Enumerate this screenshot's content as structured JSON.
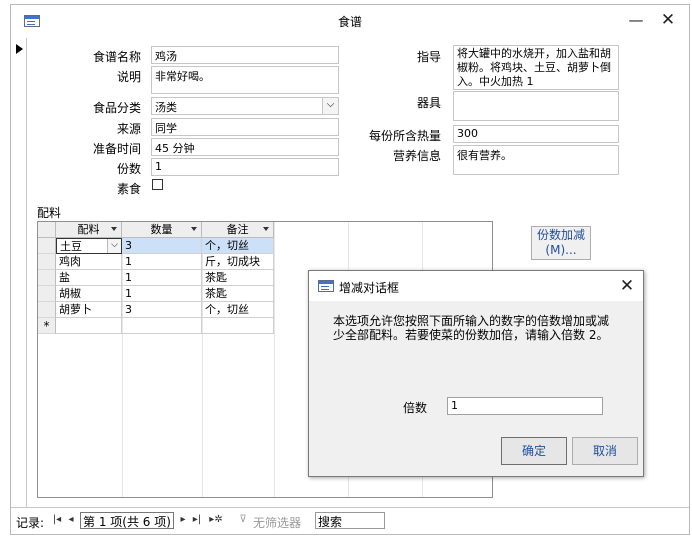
{
  "window": {
    "title": "食谱",
    "minimize_glyph": "—",
    "close_glyph": "✕"
  },
  "form": {
    "name_label": "食谱名称",
    "name_value": "鸡汤",
    "desc_label": "说明",
    "desc_value": "非常好喝。",
    "category_label": "食品分类",
    "category_value": "汤类",
    "source_label": "来源",
    "source_value": "同学",
    "prep_label": "准备时间",
    "prep_value": "45 分钟",
    "servings_label": "份数",
    "servings_value": "1",
    "veg_label": "素食",
    "veg_checked": false,
    "guide_label": "指导",
    "guide_value": "将大罐中的水烧开，加入盐和胡椒粉。将鸡块、土豆、胡萝卜倒入。中火加热 1",
    "tools_label": "器具",
    "tools_value": "",
    "calories_label": "每份所含热量",
    "calories_value": "300",
    "nutrition_label": "营养信息",
    "nutrition_value": "很有营养。"
  },
  "subform": {
    "label": "配料",
    "columns": [
      "配料",
      "数量",
      "备注"
    ],
    "rows": [
      [
        "土豆",
        "3",
        "个，切丝"
      ],
      [
        "鸡肉",
        "1",
        "斤，切成块"
      ],
      [
        "盐",
        "1",
        "茶匙"
      ],
      [
        "胡椒",
        "1",
        "茶匙"
      ],
      [
        "胡萝卜",
        "3",
        "个，切丝"
      ]
    ],
    "new_row_marker": "*"
  },
  "scale_button": {
    "line1": "份数加减",
    "line2": "(M)..."
  },
  "navbar": {
    "records_label": "记录:",
    "position": "第 1 项(共 6 项)",
    "filter_label": "无筛选器",
    "search_label": "搜索"
  },
  "dialog": {
    "title": "增减对话框",
    "message": "本选项允许您按照下面所输入的数字的倍数增加或减少全部配料。若要使菜的份数加倍，请输入倍数 2。",
    "factor_label": "倍数",
    "factor_value": "1",
    "ok_label": "确定",
    "cancel_label": "取消"
  },
  "colors": {
    "accent_text": "#1f4e9c",
    "selected_row": "#cce0f7"
  }
}
